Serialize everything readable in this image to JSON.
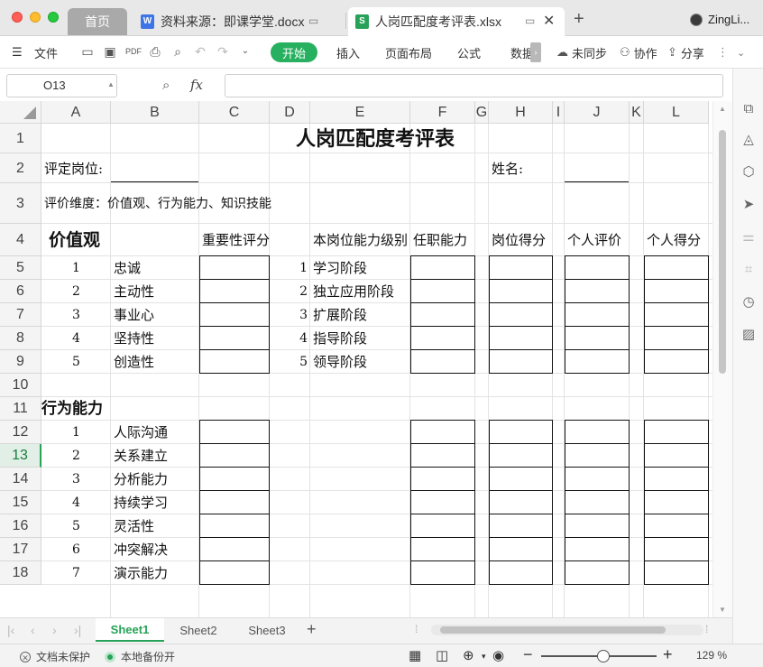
{
  "window": {
    "tabs": [
      {
        "label": "首页"
      },
      {
        "label": "资料来源：即课学堂.docx",
        "icon": "W"
      },
      {
        "label": "人岗匹配度考评表.xlsx",
        "icon": "S"
      }
    ],
    "user": "ZingLi..."
  },
  "ribbon": {
    "file_menu": "文件",
    "tabs": [
      "开始",
      "插入",
      "页面布局",
      "公式",
      "数据"
    ],
    "sync": "未同步",
    "collab": "协作",
    "share": "分享"
  },
  "formula_bar": {
    "cell_ref": "O13",
    "fx": "fx",
    "formula": ""
  },
  "columns": [
    "A",
    "B",
    "C",
    "D",
    "E",
    "F",
    "G",
    "H",
    "I",
    "J",
    "K",
    "L"
  ],
  "rows": [
    "1",
    "2",
    "3",
    "4",
    "5",
    "6",
    "7",
    "8",
    "9",
    "10",
    "11",
    "12",
    "13",
    "14",
    "15",
    "16",
    "17",
    "18"
  ],
  "active_row": "13",
  "sheet": {
    "title": "人岗匹配度考评表",
    "position_label": "评定岗位:",
    "name_label": "姓名:",
    "dimensions": "评价维度：价值观、行为能力、知识技能",
    "values_header": "价值观",
    "importance_header": "重要性评分",
    "level_header": "本岗位能力级别",
    "competency_header": "任职能力",
    "position_score_header": "岗位得分",
    "self_eval_header": "个人评价",
    "personal_score_header": "个人得分",
    "values": [
      {
        "no": "1",
        "name": "忠诚",
        "lvl": "1",
        "stage": "学习阶段"
      },
      {
        "no": "2",
        "name": "主动性",
        "lvl": "2",
        "stage": "独立应用阶段"
      },
      {
        "no": "3",
        "name": "事业心",
        "lvl": "3",
        "stage": "扩展阶段"
      },
      {
        "no": "4",
        "name": "坚持性",
        "lvl": "4",
        "stage": "指导阶段"
      },
      {
        "no": "5",
        "name": "创造性",
        "lvl": "5",
        "stage": "领导阶段"
      }
    ],
    "behavior_header": "行为能力",
    "behaviors": [
      {
        "no": "1",
        "name": "人际沟通"
      },
      {
        "no": "2",
        "name": "关系建立"
      },
      {
        "no": "3",
        "name": "分析能力"
      },
      {
        "no": "4",
        "name": "持续学习"
      },
      {
        "no": "5",
        "name": "灵活性"
      },
      {
        "no": "6",
        "name": "冲突解决"
      },
      {
        "no": "7",
        "name": "演示能力"
      }
    ]
  },
  "sheet_tabs": [
    "Sheet1",
    "Sheet2",
    "Sheet3"
  ],
  "active_sheet": "Sheet1",
  "status": {
    "protect": "文档未保护",
    "backup": "本地备份开",
    "zoom": "129 %"
  },
  "colors": {
    "accent": "#27a258",
    "start_button": "#27b05f"
  }
}
